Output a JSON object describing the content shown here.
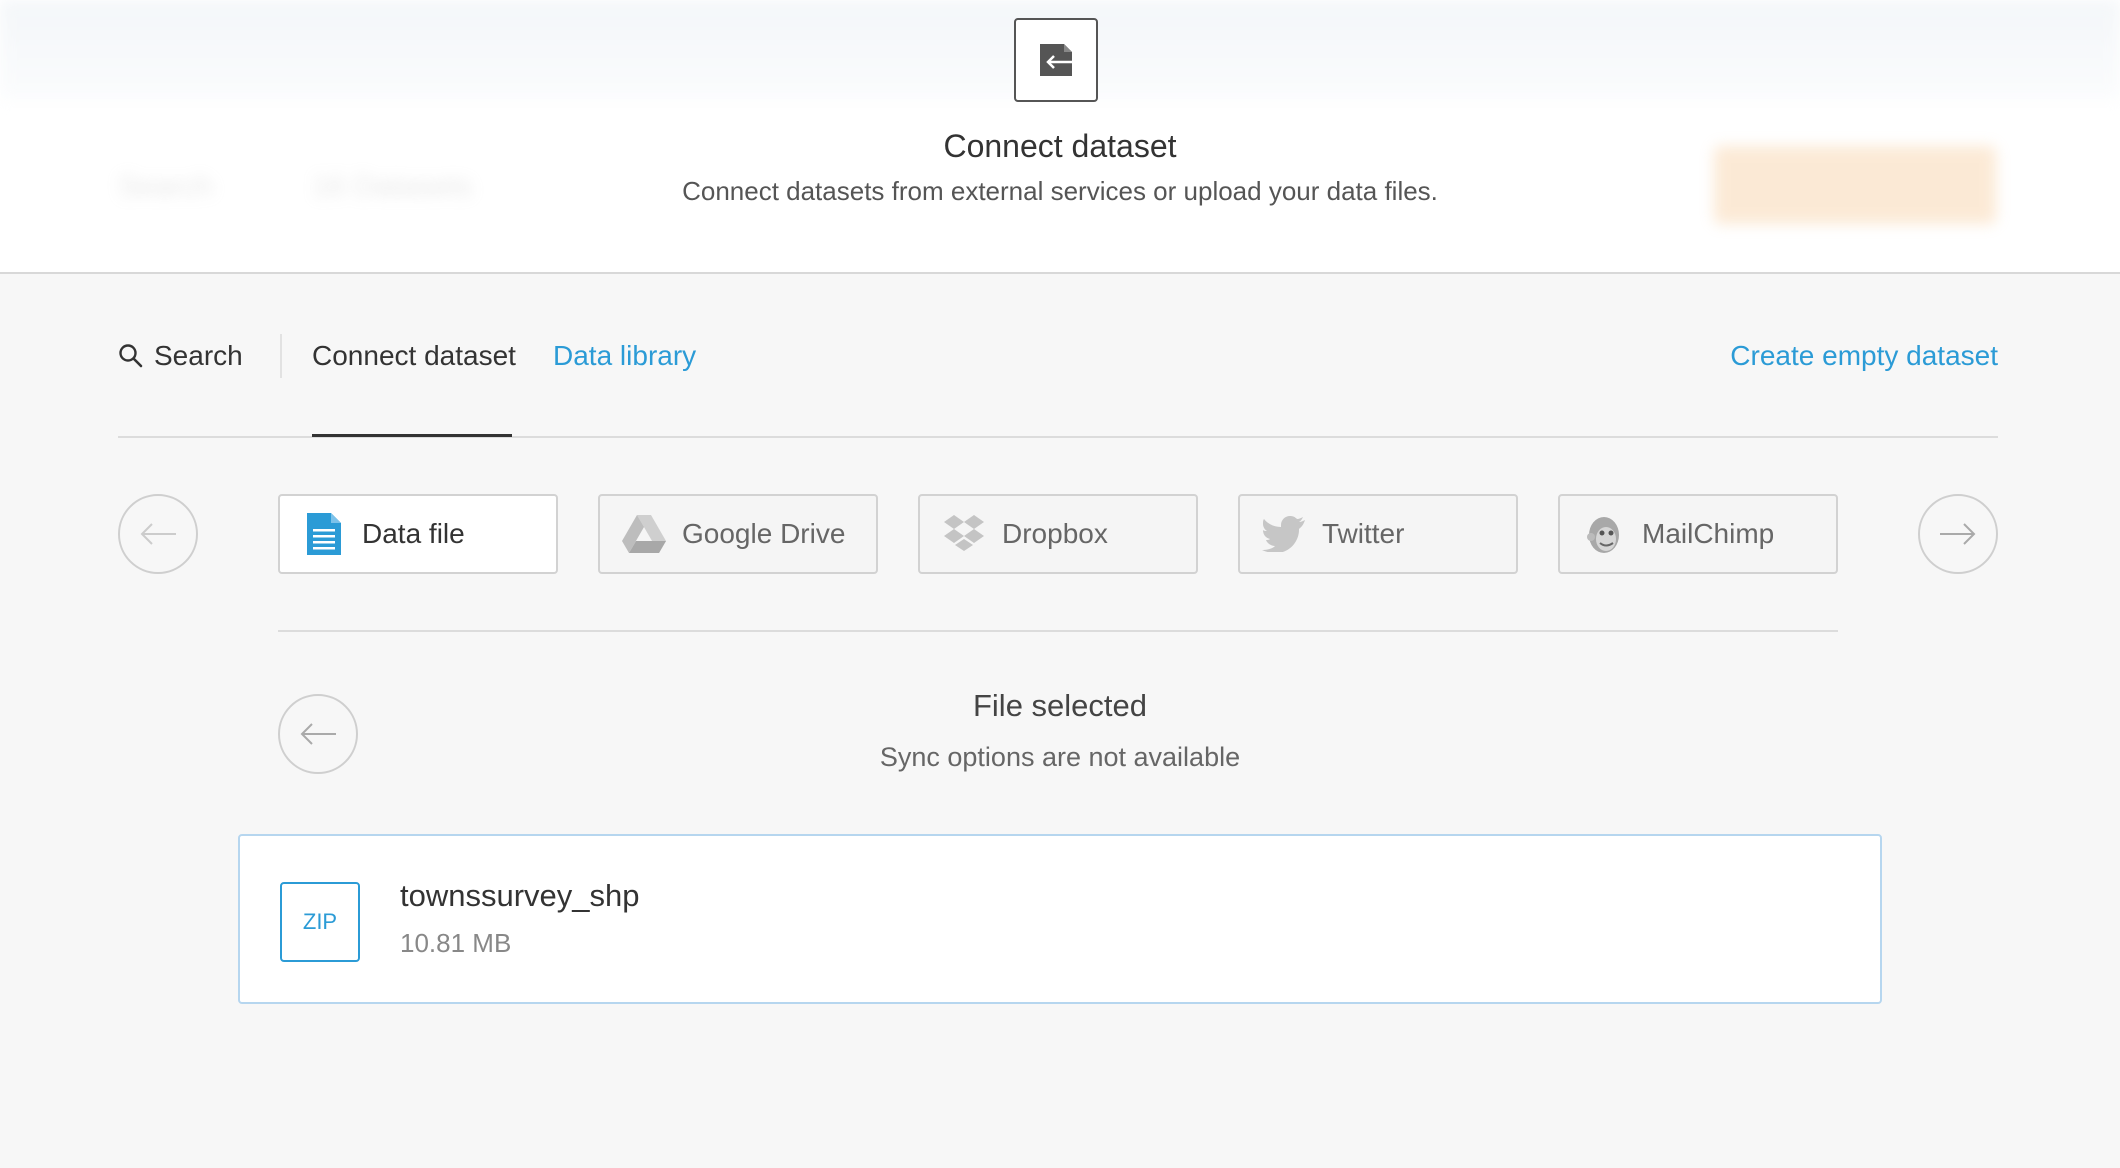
{
  "background": {
    "search_label": "Search",
    "dataset_count": "16 Datasets"
  },
  "modal": {
    "title": "Connect dataset",
    "subtitle": "Connect datasets from external services or upload your data files.",
    "icon": "import-arrow-icon"
  },
  "tabs": {
    "search": "Search",
    "connect": "Connect dataset",
    "library": "Data library",
    "create": "Create empty dataset"
  },
  "sources": [
    {
      "label": "Data file",
      "icon": "data-file-icon",
      "active": true
    },
    {
      "label": "Google Drive",
      "icon": "google-drive-icon",
      "active": false
    },
    {
      "label": "Dropbox",
      "icon": "dropbox-icon",
      "active": false
    },
    {
      "label": "Twitter",
      "icon": "twitter-icon",
      "active": false
    },
    {
      "label": "MailChimp",
      "icon": "mailchimp-icon",
      "active": false
    }
  ],
  "file_selected": {
    "title": "File selected",
    "subtitle": "Sync options are not available"
  },
  "file": {
    "type": "ZIP",
    "name": "townssurvey_shp",
    "size": "10.81 MB"
  },
  "colors": {
    "accent": "#2b9bd6",
    "text": "#333333",
    "muted": "#888888"
  }
}
